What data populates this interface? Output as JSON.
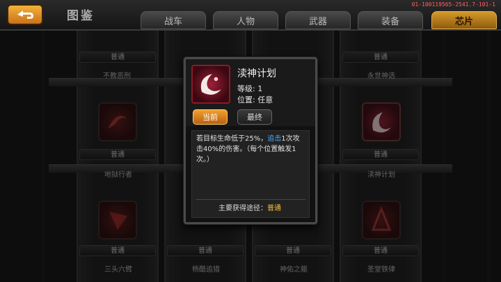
{
  "topbar": {
    "title": "图鉴",
    "code": "01-100119565-2541.7-101-1",
    "tabs": [
      {
        "label": "战车",
        "active": false
      },
      {
        "label": "人物",
        "active": false
      },
      {
        "label": "武器",
        "active": false
      },
      {
        "label": "装备",
        "active": false
      },
      {
        "label": "芯片",
        "active": true
      }
    ]
  },
  "grid": {
    "rarity_label": "普通",
    "names": [
      "不教恶刑",
      "永世神选",
      "地狱行者",
      "渎神计划",
      "三头六臂",
      "杨酷追猎",
      "神佑之躯",
      "圣堂铁律"
    ]
  },
  "popup": {
    "name": "渎神计划",
    "level_label": "等级: 1",
    "position_label": "位置: 任意",
    "btn_current": "当前",
    "btn_final": "最终",
    "desc_part1": "若目标生命低于25%，",
    "desc_highlight": "追击",
    "desc_part2": "1次攻击40%的伤害。（每个位置触发1次。）",
    "source_prefix": "主要获得途径：",
    "source_value": "普通"
  },
  "colors": {
    "accent": "#f0a030",
    "highlight": "#4aa8ff",
    "source": "#f0c040"
  }
}
